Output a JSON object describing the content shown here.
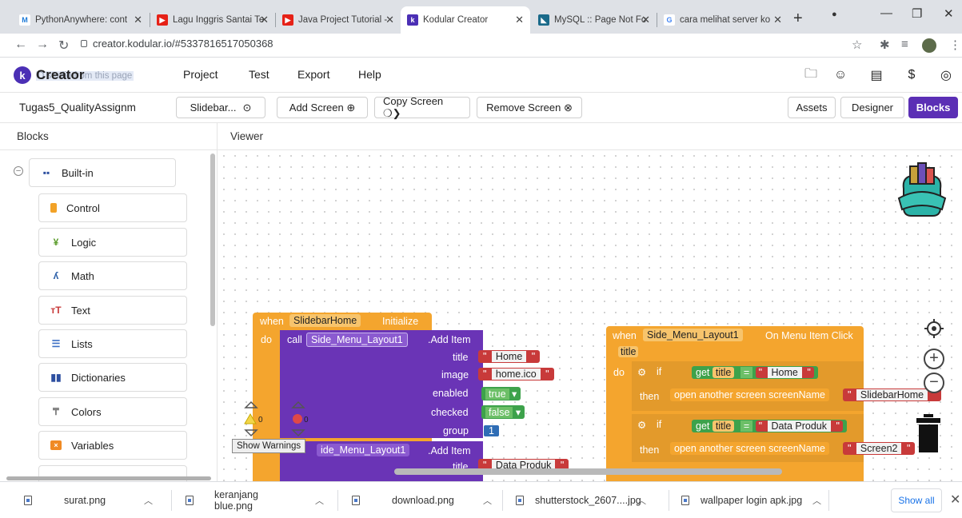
{
  "browser": {
    "tabs": [
      {
        "label": "PythonAnywhere: cont",
        "favicon_color": "#1d7bd8",
        "favicon_text": "M"
      },
      {
        "label": "Lagu Inggris Santai Te",
        "favicon_color": "#e62117",
        "favicon_text": "▶"
      },
      {
        "label": "Java Project Tutorial -",
        "favicon_color": "#e62117",
        "favicon_text": "▶"
      },
      {
        "label": "Kodular Creator",
        "favicon_color": "#4b2fb5",
        "favicon_text": "k"
      },
      {
        "label": "MySQL :: Page Not Fo",
        "favicon_color": "#1a6a8a",
        "favicon_text": "◣"
      },
      {
        "label": "cara melihat server ko",
        "favicon_color": "#ffffff",
        "favicon_text": "G"
      }
    ],
    "url": "creator.kodular.io/#5337816517050368"
  },
  "app": {
    "title": "Creator",
    "ghost_text": "D    studio from this page",
    "menu": [
      "Project",
      "Test",
      "Export",
      "Help"
    ]
  },
  "toolbar": {
    "project_name": "Tugas5_QualityAssignm",
    "screen_select": "Slidebar...",
    "add_screen": "Add Screen ⊕",
    "copy_screen": "Copy Screen ❍❯",
    "remove_screen": "Remove Screen ⊗",
    "assets": "Assets",
    "designer": "Designer",
    "blocks": "Blocks"
  },
  "panels": {
    "blocks_header": "Blocks",
    "viewer_header": "Viewer"
  },
  "palette": {
    "builtin": "Built-in",
    "items": [
      {
        "label": "Control",
        "icon": "control-icon",
        "color": "#f2a227"
      },
      {
        "label": "Logic",
        "icon": "logic-icon",
        "color": "#5a9c2a"
      },
      {
        "label": "Math",
        "icon": "math-icon",
        "color": "#2b5fa8"
      },
      {
        "label": "Text",
        "icon": "text-icon",
        "color": "#c83a3a"
      },
      {
        "label": "Lists",
        "icon": "lists-icon",
        "color": "#3d6fc4"
      },
      {
        "label": "Dictionaries",
        "icon": "dictionaries-icon",
        "color": "#2d4fa0"
      },
      {
        "label": "Colors",
        "icon": "colors-icon",
        "color": "#777777"
      },
      {
        "label": "Variables",
        "icon": "variables-icon",
        "color": "#f08a24"
      }
    ]
  },
  "blocks": {
    "init": {
      "when": "when",
      "component": "SlidebarHome",
      "event": "Initialize",
      "do": "do",
      "call": "call",
      "target": "Side_Menu_Layout1",
      "method": ".Add Item",
      "params": {
        "title": "title",
        "image": "image",
        "enabled": "enabled",
        "checked": "checked",
        "group": "group"
      },
      "values": {
        "title": "Home",
        "image": "home.ico",
        "enabled": "true",
        "checked": "false",
        "group": "1"
      },
      "call2_target": "ide_Menu_Layout1",
      "call2_method": ".Add Item",
      "call2_title_label": "title",
      "call2_title": "Data Produk"
    },
    "click": {
      "when": "when",
      "component": "Side_Menu_Layout1",
      "event": "On Menu Item Click",
      "param": "title",
      "do": "do",
      "if": "if",
      "then": "then",
      "get": "get",
      "var": "title",
      "eq": "=",
      "cmp1": "Home",
      "cmp2": "Data Produk",
      "open": "open another screen  screenName",
      "screen1": "SlidebarHome",
      "screen2": "Screen2"
    }
  },
  "warnings": {
    "warn_count": "0",
    "err_count": "0",
    "tooltip": "Show Warnings"
  },
  "downloads": {
    "files": [
      "surat.png",
      "keranjang blue.png",
      "download.png",
      "shutterstock_2607....jpg",
      "wallpaper login apk.jpg"
    ],
    "show_all": "Show all"
  }
}
